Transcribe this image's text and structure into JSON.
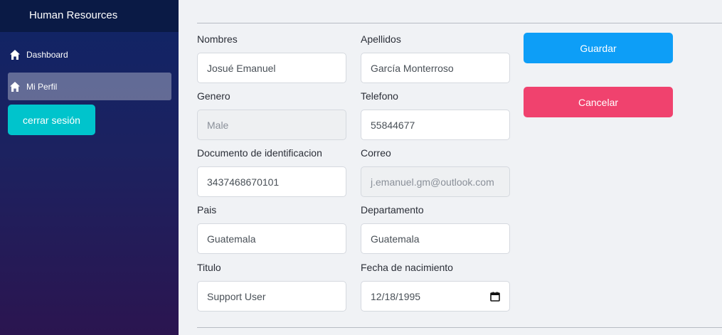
{
  "sidebar": {
    "title": "Human Resources",
    "items": [
      {
        "label": "Dashboard",
        "icon": "home-icon"
      },
      {
        "label": "Mi Perfil",
        "icon": "home-icon"
      }
    ],
    "logout_label": "cerrar sesión"
  },
  "form": {
    "nombres": {
      "label": "Nombres",
      "value": "Josué Emanuel"
    },
    "apellidos": {
      "label": "Apellidos",
      "value": "García Monterroso"
    },
    "genero": {
      "label": "Genero",
      "value": "Male"
    },
    "telefono": {
      "label": "Telefono",
      "value": "55844677"
    },
    "documento": {
      "label": "Documento de identificacion",
      "value": "3437468670101"
    },
    "correo": {
      "label": "Correo",
      "value": "j.emanuel.gm@outlook.com"
    },
    "pais": {
      "label": "Pais",
      "value": "Guatemala"
    },
    "departamento": {
      "label": "Departamento",
      "value": "Guatemala"
    },
    "titulo": {
      "label": "Titulo",
      "value": "Support User"
    },
    "fecha": {
      "label": "Fecha de nacimiento",
      "value": "12/18/1995"
    }
  },
  "actions": {
    "save_label": "Guardar",
    "cancel_label": "Cancelar"
  },
  "colors": {
    "save": "#0d9ef7",
    "cancel": "#f0426e",
    "logout": "#00c4cc"
  }
}
